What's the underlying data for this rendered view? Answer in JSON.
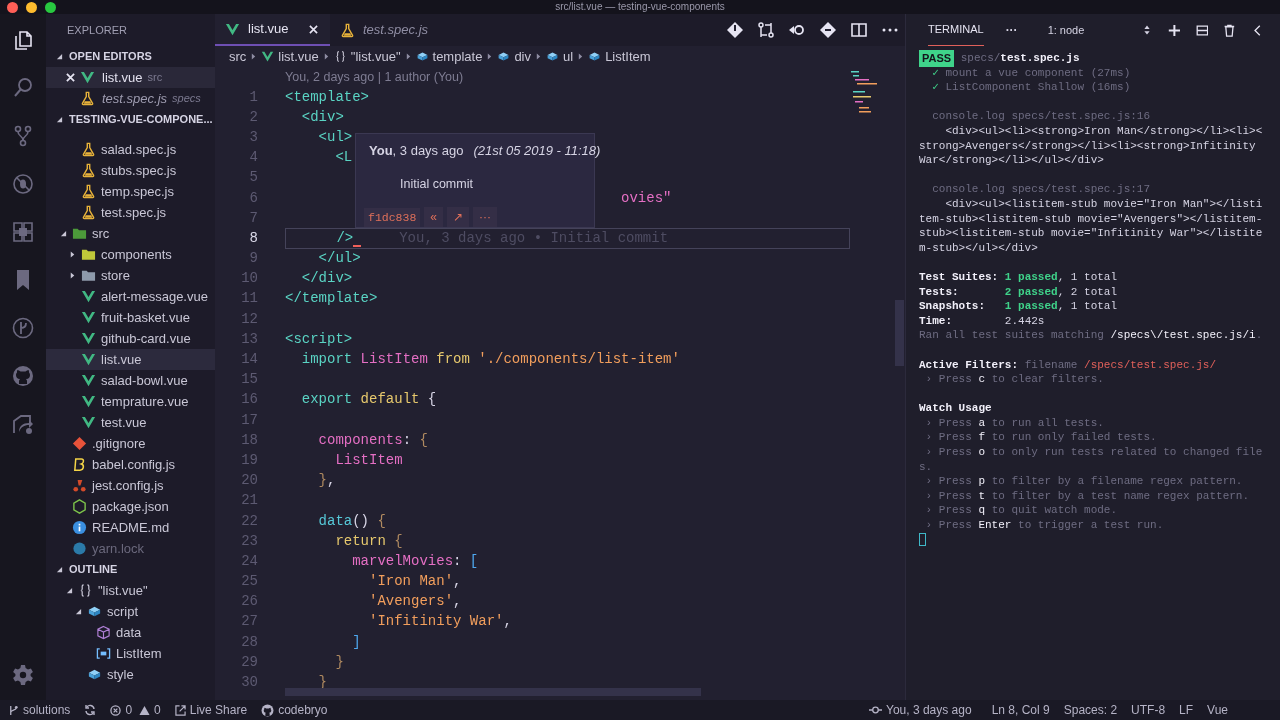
{
  "window": {
    "title": "src/list.vue — testing-vue-components"
  },
  "activity_bar": [
    {
      "kind": "files",
      "selected": true
    },
    {
      "kind": "search",
      "selected": false
    },
    {
      "kind": "source-control",
      "selected": false
    },
    {
      "kind": "debug",
      "selected": false
    },
    {
      "kind": "extensions",
      "selected": false
    },
    {
      "kind": "bookmark",
      "selected": false
    },
    {
      "kind": "history",
      "selected": false
    },
    {
      "kind": "github",
      "selected": false
    },
    {
      "kind": "share",
      "selected": false
    }
  ],
  "sidebar": {
    "title": "EXPLORER",
    "open_editors": {
      "title": "OPEN EDITORS",
      "expanded": true,
      "items": [
        {
          "name": "list.vue",
          "folder": "src",
          "kind": "vue",
          "selected": true,
          "preview": false
        },
        {
          "name": "test.spec.js",
          "folder": "specs",
          "kind": "test",
          "selected": false,
          "preview": true
        }
      ]
    },
    "project": {
      "title": "TESTING-VUE-COMPONE...",
      "expanded": true,
      "tree": [
        {
          "children": [
            {
              "label": "salad.spec.js",
              "kind": "test",
              "selected": false
            },
            {
              "label": "stubs.spec.js",
              "kind": "test",
              "selected": false
            },
            {
              "label": "temp.spec.js",
              "kind": "test",
              "selected": false
            },
            {
              "label": "test.spec.js",
              "kind": "test",
              "selected": false
            }
          ]
        },
        {
          "label": "src",
          "kind": "folder-src",
          "expanded": true,
          "selected": false,
          "ignored": false,
          "children": [
            {
              "label": "components",
              "kind": "folder-lib",
              "expanded": false,
              "selected": false
            },
            {
              "label": "store",
              "kind": "folder",
              "expanded": false,
              "selected": false
            },
            {
              "label": "alert-message.vue",
              "kind": "vue",
              "selected": false
            },
            {
              "label": "fruit-basket.vue",
              "kind": "vue",
              "selected": false
            },
            {
              "label": "github-card.vue",
              "kind": "vue",
              "selected": false
            },
            {
              "label": "list.vue",
              "kind": "vue",
              "selected": true
            },
            {
              "label": "salad-bowl.vue",
              "kind": "vue",
              "selected": false
            },
            {
              "label": "temprature.vue",
              "kind": "vue",
              "selected": false
            },
            {
              "label": "test.vue",
              "kind": "vue",
              "selected": false
            }
          ]
        },
        {
          "label": ".gitignore",
          "kind": "git",
          "selected": false,
          "ignored": false
        },
        {
          "label": "babel.config.js",
          "kind": "babel",
          "selected": false,
          "ignored": false
        },
        {
          "label": "jest.config.js",
          "kind": "jest",
          "selected": false,
          "ignored": false
        },
        {
          "label": "package.json",
          "kind": "node",
          "selected": false,
          "ignored": false
        },
        {
          "label": "README.md",
          "kind": "info",
          "selected": false,
          "ignored": false
        },
        {
          "label": "yarn.lock",
          "kind": "yarn",
          "selected": false,
          "ignored": true
        }
      ]
    },
    "outline": {
      "title": "OUTLINE",
      "expanded": true,
      "tree": [
        {
          "label": "\"list.vue\"",
          "kind": "braces",
          "expanded": true,
          "children": [
            {
              "label": "script",
              "kind": "module",
              "expanded": true,
              "children": [
                {
                  "label": "data",
                  "kind": "cube"
                },
                {
                  "label": "ListItem",
                  "kind": "field"
                }
              ]
            },
            {
              "label": "style",
              "kind": "module"
            }
          ]
        }
      ]
    }
  },
  "editor": {
    "tabs": [
      {
        "label": "list.vue",
        "kind": "vue",
        "selected": true,
        "preview": false
      },
      {
        "label": "test.spec.js",
        "kind": "test",
        "selected": false,
        "preview": true
      }
    ],
    "breadcrumbs": [
      {
        "label": "src"
      },
      {
        "label": "list.vue",
        "kind": "vue"
      },
      {
        "label": "\"list.vue\"",
        "kind": "braces"
      },
      {
        "label": "template",
        "kind": "module"
      },
      {
        "label": "div",
        "kind": "module"
      },
      {
        "label": "ul",
        "kind": "module"
      },
      {
        "label": "ListItem",
        "kind": "module"
      }
    ],
    "code_lens": "You, 2 days ago | 1 author (You)",
    "lines": [
      {
        "number": "1",
        "current": false,
        "tokens": [
          {
            "text": "<template>",
            "kind": "tag"
          }
        ]
      },
      {
        "number": "2",
        "current": false,
        "tokens": [
          {
            "text": "  <div>",
            "kind": "tag"
          }
        ]
      },
      {
        "number": "3",
        "current": false,
        "tokens": [
          {
            "text": "    <ul>",
            "kind": "tag"
          }
        ]
      },
      {
        "number": "4",
        "current": false,
        "tokens": [
          {
            "text": "      <L",
            "kind": "tag"
          }
        ]
      },
      {
        "number": "5",
        "current": false
      },
      {
        "number": "6",
        "current": false,
        "tokens": [
          {
            "text": "                                        ovies\"",
            "kind": "ident"
          }
        ]
      },
      {
        "number": "7",
        "current": false
      },
      {
        "number": "8",
        "current": true,
        "tokens": [
          {
            "text": "      />",
            "kind": "tag"
          }
        ],
        "blame": "You, 3 days ago • Initial commit"
      },
      {
        "number": "9",
        "current": false,
        "tokens": [
          {
            "text": "    </ul>",
            "kind": "tag"
          }
        ]
      },
      {
        "number": "10",
        "current": false,
        "tokens": [
          {
            "text": "  </div>",
            "kind": "tag"
          }
        ]
      },
      {
        "number": "11",
        "current": false,
        "tokens": [
          {
            "text": "</template>",
            "kind": "tag"
          }
        ]
      },
      {
        "number": "12",
        "current": false
      },
      {
        "number": "13",
        "current": false,
        "tokens": [
          {
            "text": "<script>",
            "kind": "tag"
          }
        ]
      },
      {
        "number": "14",
        "current": false,
        "tokens": [
          {
            "text": "  import",
            "kind": "kw"
          },
          {
            "text": " ListItem",
            "kind": "ident"
          },
          {
            "text": " from",
            "kind": "kw2"
          },
          {
            "text": " './components/list-item'",
            "kind": "str"
          }
        ]
      },
      {
        "number": "15",
        "current": false
      },
      {
        "number": "16",
        "current": false,
        "tokens": [
          {
            "text": "  export",
            "kind": "kw"
          },
          {
            "text": " default",
            "kind": "kw2"
          },
          {
            "text": " {",
            "kind": "punct"
          }
        ]
      },
      {
        "number": "17",
        "current": false
      },
      {
        "number": "18",
        "current": false,
        "tokens": [
          {
            "text": "    components",
            "kind": "ident"
          },
          {
            "text": ":",
            "kind": "punct"
          },
          {
            "text": " {",
            "kind": "brace"
          }
        ]
      },
      {
        "number": "19",
        "current": false,
        "tokens": [
          {
            "text": "      ListItem",
            "kind": "ident"
          }
        ]
      },
      {
        "number": "20",
        "current": false,
        "tokens": [
          {
            "text": "    }",
            "kind": "brace"
          },
          {
            "text": ",",
            "kind": "punct"
          }
        ]
      },
      {
        "number": "21",
        "current": false
      },
      {
        "number": "22",
        "current": false,
        "tokens": [
          {
            "text": "    data",
            "kind": "func"
          },
          {
            "text": "()",
            "kind": "punct"
          },
          {
            "text": " {",
            "kind": "brace"
          }
        ]
      },
      {
        "number": "23",
        "current": false,
        "tokens": [
          {
            "text": "      return",
            "kind": "kw2"
          },
          {
            "text": " {",
            "kind": "brace"
          }
        ]
      },
      {
        "number": "24",
        "current": false,
        "tokens": [
          {
            "text": "        marvelMovies",
            "kind": "ident"
          },
          {
            "text": ":",
            "kind": "punct"
          },
          {
            "text": " [",
            "kind": "bracket"
          }
        ]
      },
      {
        "number": "25",
        "current": false,
        "tokens": [
          {
            "text": "          'Iron Man'",
            "kind": "str"
          },
          {
            "text": ",",
            "kind": "punct"
          }
        ]
      },
      {
        "number": "26",
        "current": false,
        "tokens": [
          {
            "text": "          'Avengers'",
            "kind": "str"
          },
          {
            "text": ",",
            "kind": "punct"
          }
        ]
      },
      {
        "number": "27",
        "current": false,
        "tokens": [
          {
            "text": "          'Infitinity War'",
            "kind": "str"
          },
          {
            "text": ",",
            "kind": "punct"
          }
        ]
      },
      {
        "number": "28",
        "current": false,
        "tokens": [
          {
            "text": "        ]",
            "kind": "bracket"
          }
        ]
      },
      {
        "number": "29",
        "current": false,
        "tokens": [
          {
            "text": "      }",
            "kind": "brace"
          }
        ]
      },
      {
        "number": "30",
        "current": false,
        "tokens": [
          {
            "text": "    }",
            "kind": "brace"
          }
        ]
      }
    ],
    "hover": {
      "heading": "**You**, 3 days ago",
      "date": "(21st 05 2019 - 11:18)",
      "message": "Initial commit",
      "commit": "f1dc838",
      "actions": [
        "«",
        "↗",
        "···"
      ]
    }
  },
  "terminal": {
    "tabs": [
      {
        "label": "TERMINAL",
        "selected": true
      }
    ],
    "more": "···",
    "selector": "1: node",
    "blocks": [
      [
        [
          {
            "text": "PASS",
            "kind": "pass"
          },
          {
            "text": " specs/",
            "kind": "dim"
          },
          {
            "text": "test.spec.js",
            "kind": "bold"
          }
        ],
        [
          {
            "text": "  ✓ ",
            "kind": "ok"
          },
          {
            "text": "mount a vue component (27ms)",
            "kind": "dim"
          }
        ],
        [
          {
            "text": "  ✓ ",
            "kind": "ok"
          },
          {
            "text": "ListComponent Shallow (16ms)",
            "kind": "dim"
          }
        ]
      ],
      [
        [
          {
            "text": "  console.log specs/test.spec.js:16",
            "kind": "dim"
          }
        ],
        [
          {
            "text": "    <div><ul><li><strong>Iron Man</strong></li><li><",
            "kind": "plain"
          }
        ],
        [
          {
            "text": "strong>Avengers</strong></li><li><strong>Infitinity",
            "kind": "plain"
          }
        ],
        [
          {
            "text": "War</strong></li></ul></div>",
            "kind": "plain"
          }
        ]
      ],
      [
        [
          {
            "text": "  console.log specs/test.spec.js:17",
            "kind": "dim"
          }
        ],
        [
          {
            "text": "    <div><ul><listitem-stub movie=\"Iron Man\"></listi",
            "kind": "plain"
          }
        ],
        [
          {
            "text": "tem-stub><listitem-stub movie=\"Avengers\"></listitem-",
            "kind": "plain"
          }
        ],
        [
          {
            "text": "stub><listitem-stub movie=\"Infitinity War\"></listite",
            "kind": "plain"
          }
        ],
        [
          {
            "text": "m-stub></ul></div>",
            "kind": "plain"
          }
        ]
      ],
      [
        [
          {
            "text": "Test Suites: ",
            "kind": "bold"
          },
          {
            "text": "1 passed",
            "kind": "green"
          },
          {
            "text": ", 1 total",
            "kind": "plain"
          }
        ],
        [
          {
            "text": "Tests:       ",
            "kind": "bold"
          },
          {
            "text": "2 passed",
            "kind": "green"
          },
          {
            "text": ", 2 total",
            "kind": "plain"
          }
        ],
        [
          {
            "text": "Snapshots:   ",
            "kind": "bold"
          },
          {
            "text": "1 passed",
            "kind": "green"
          },
          {
            "text": ", 1 total",
            "kind": "plain"
          }
        ],
        [
          {
            "text": "Time:        ",
            "kind": "bold"
          },
          {
            "text": "2.442s",
            "kind": "plain"
          }
        ],
        [
          {
            "text": "Ran all test suites matching ",
            "kind": "dim"
          },
          {
            "text": "/specs\\/test.spec.js/i",
            "kind": "white"
          },
          {
            "text": ".",
            "kind": "dim"
          }
        ]
      ],
      [
        [
          {
            "text": "Active Filters: ",
            "kind": "bold"
          },
          {
            "text": "filename ",
            "kind": "dim"
          },
          {
            "text": "/specs/test.spec.js/",
            "kind": "red"
          }
        ],
        [
          {
            "text": " › Press ",
            "kind": "dim"
          },
          {
            "text": "c",
            "kind": "white"
          },
          {
            "text": " to clear filters.",
            "kind": "dim"
          }
        ]
      ],
      [
        [
          {
            "text": "Watch Usage",
            "kind": "bold"
          }
        ],
        [
          {
            "text": " › Press ",
            "kind": "dim"
          },
          {
            "text": "a",
            "kind": "white"
          },
          {
            "text": " to run all tests.",
            "kind": "dim"
          }
        ],
        [
          {
            "text": " › Press ",
            "kind": "dim"
          },
          {
            "text": "f",
            "kind": "white"
          },
          {
            "text": " to run only failed tests.",
            "kind": "dim"
          }
        ],
        [
          {
            "text": " › Press ",
            "kind": "dim"
          },
          {
            "text": "o",
            "kind": "white"
          },
          {
            "text": " to only run tests related to changed file",
            "kind": "dim"
          }
        ],
        [
          {
            "text": "s.",
            "kind": "dim"
          }
        ],
        [
          {
            "text": " › Press ",
            "kind": "dim"
          },
          {
            "text": "p",
            "kind": "white"
          },
          {
            "text": " to filter by a filename regex pattern.",
            "kind": "dim"
          }
        ],
        [
          {
            "text": " › Press ",
            "kind": "dim"
          },
          {
            "text": "t",
            "kind": "white"
          },
          {
            "text": " to filter by a test name regex pattern.",
            "kind": "dim"
          }
        ],
        [
          {
            "text": " › Press ",
            "kind": "dim"
          },
          {
            "text": "q",
            "kind": "white"
          },
          {
            "text": " to quit watch mode.",
            "kind": "dim"
          }
        ],
        [
          {
            "text": " › Press ",
            "kind": "dim"
          },
          {
            "text": "Enter",
            "kind": "white"
          },
          {
            "text": " to trigger a test run.",
            "kind": "dim"
          }
        ],
        [
          {
            "kind": "cursor"
          }
        ]
      ]
    ]
  },
  "status_bar": {
    "branch": "solutions",
    "errors": "0",
    "warnings": "0",
    "live_share": "Live Share",
    "account": "codebryo",
    "blame": "You, 3 days ago",
    "items": [
      "Ln 8, Col 9",
      "Spaces: 2",
      "UTF-8",
      "LF",
      "Vue"
    ]
  }
}
